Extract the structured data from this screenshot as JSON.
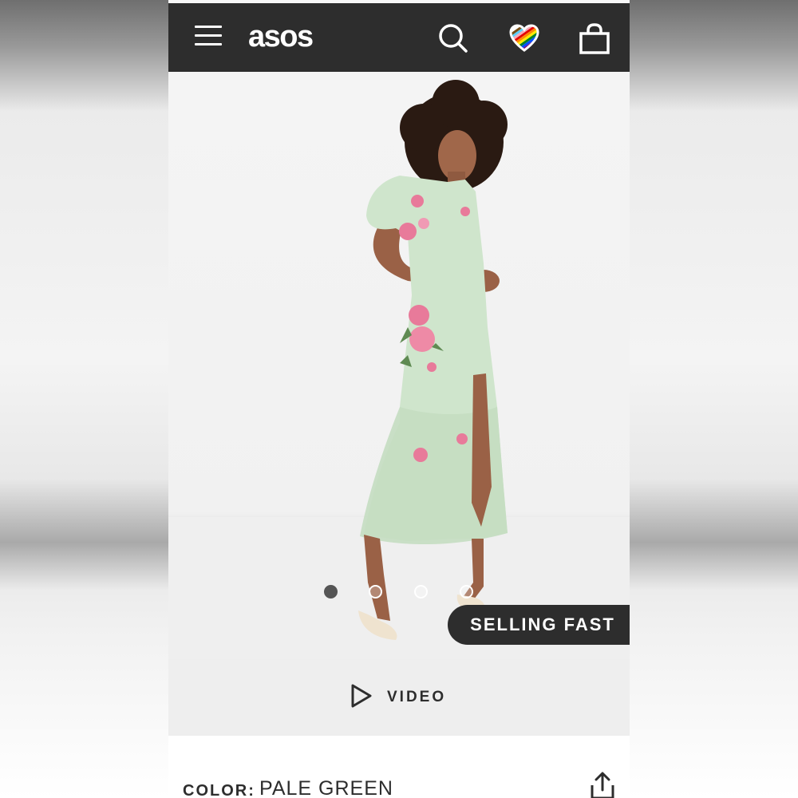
{
  "header": {
    "logo_text": "asos",
    "icons": [
      "menu-icon",
      "search-icon",
      "saved-items-heart-icon",
      "shopping-bag-icon"
    ],
    "background_color": "#2d2d2d"
  },
  "gallery": {
    "image_count": 4,
    "active_index": 0,
    "badge_text": "SELLING FAST"
  },
  "video": {
    "label": "VIDEO",
    "icon": "play-icon"
  },
  "product": {
    "color_label": "COLOR:",
    "color_value": "PALE GREEN",
    "share_icon": "share-icon"
  },
  "colors": {
    "dark": "#2d2d2d",
    "accent_dress": "#cfe5cc",
    "flower_pink": "#e87a9a"
  }
}
